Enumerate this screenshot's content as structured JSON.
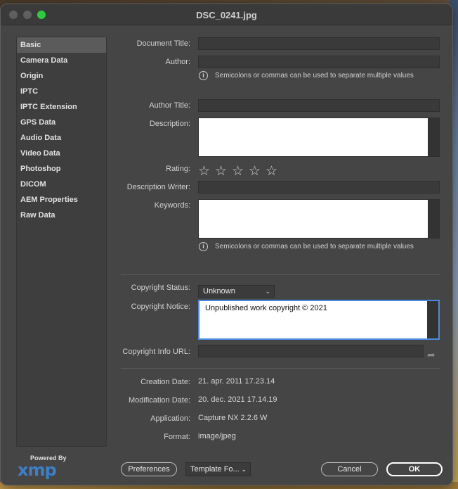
{
  "window": {
    "title": "DSC_0241.jpg"
  },
  "sidebar": {
    "items": [
      {
        "label": "Basic"
      },
      {
        "label": "Camera Data"
      },
      {
        "label": "Origin"
      },
      {
        "label": "IPTC"
      },
      {
        "label": "IPTC Extension"
      },
      {
        "label": "GPS Data"
      },
      {
        "label": "Audio Data"
      },
      {
        "label": "Video Data"
      },
      {
        "label": "Photoshop"
      },
      {
        "label": "DICOM"
      },
      {
        "label": "AEM Properties"
      },
      {
        "label": "Raw Data"
      }
    ],
    "active_index": 0
  },
  "form": {
    "document_title_label": "Document Title:",
    "document_title_value": "",
    "author_label": "Author:",
    "author_value": "",
    "author_hint": "Semicolons or commas can be used to separate multiple values",
    "author_title_label": "Author Title:",
    "author_title_value": "",
    "description_label": "Description:",
    "description_value": "",
    "rating_label": "Rating:",
    "rating_value": 0,
    "rating_max": 5,
    "description_writer_label": "Description Writer:",
    "description_writer_value": "",
    "keywords_label": "Keywords:",
    "keywords_value": "",
    "keywords_hint": "Semicolons or commas can be used to separate multiple values",
    "copyright_status_label": "Copyright Status:",
    "copyright_status_value": "Unknown",
    "copyright_notice_label": "Copyright Notice:",
    "copyright_notice_value": "Unpublished work copyright © 2021",
    "copyright_url_label": "Copyright Info URL:",
    "copyright_url_value": ""
  },
  "info": {
    "creation_date_label": "Creation Date:",
    "creation_date_value": "21. apr. 2011 17.23.14",
    "modification_date_label": "Modification Date:",
    "modification_date_value": "20. dec. 2021 17.14.19",
    "application_label": "Application:",
    "application_value": "Capture NX 2.2.6 W",
    "format_label": "Format:",
    "format_value": "image/jpeg"
  },
  "footer": {
    "powered_by": "Powered By",
    "xmp_logo_text": "xmp",
    "preferences_label": "Preferences",
    "template_label": "Template Fo...",
    "cancel_label": "Cancel",
    "ok_label": "OK"
  },
  "colors": {
    "window_bg": "#454545",
    "accent_focus": "#4a8ae0",
    "xmp_blue": "#3d7fc9",
    "maximize_green": "#2fc841"
  }
}
